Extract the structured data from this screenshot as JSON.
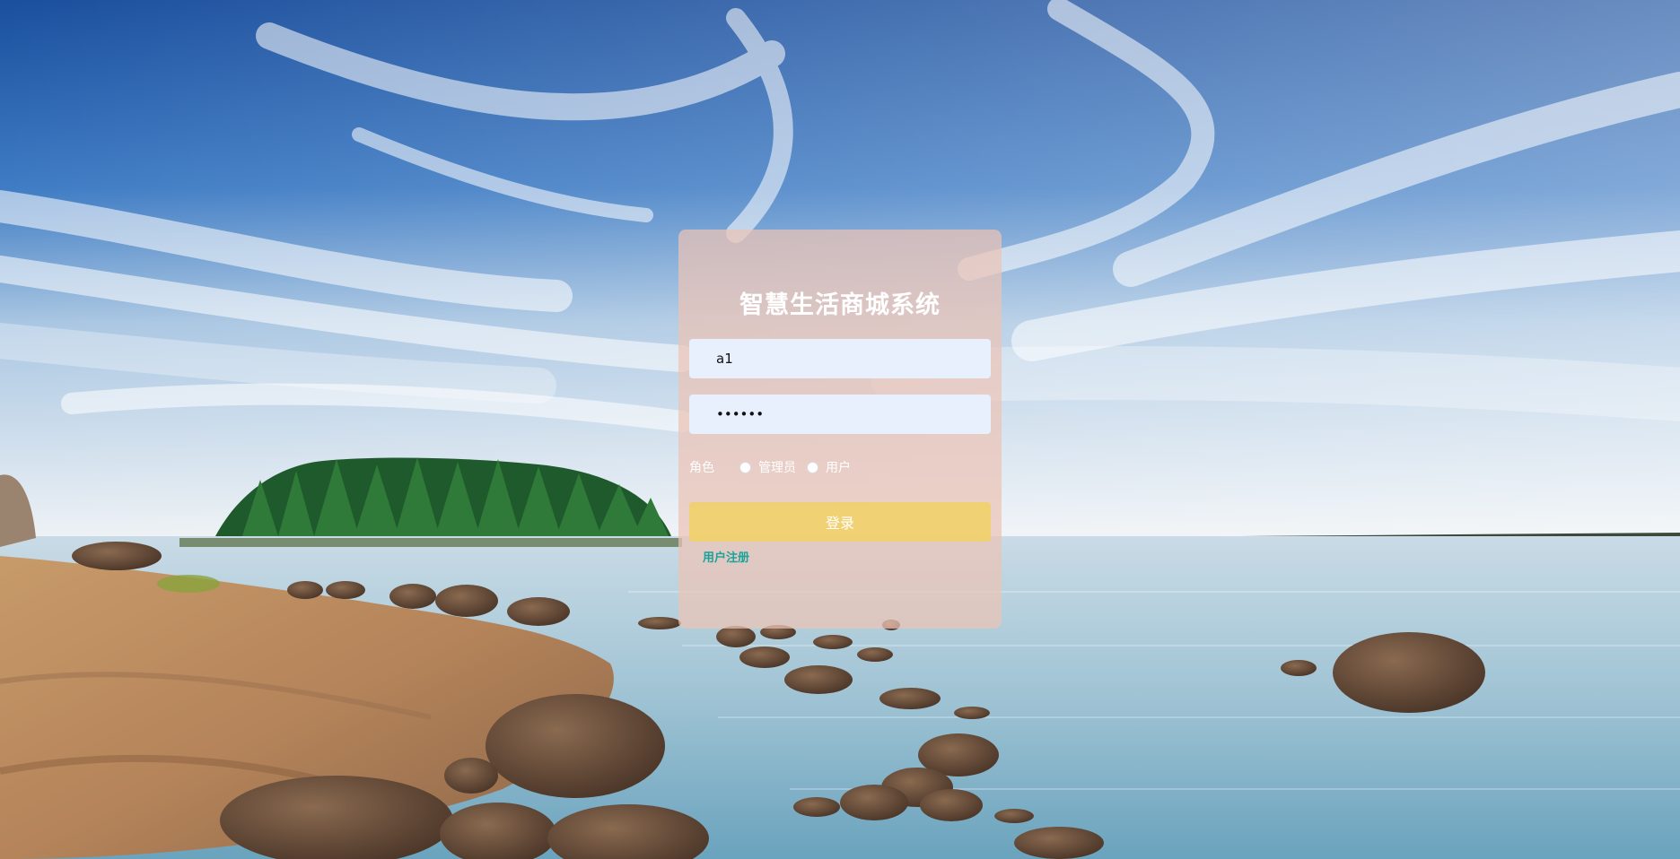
{
  "login": {
    "title": "智慧生活商城系统",
    "username_value": "a1",
    "password_value": "••••••",
    "role_label": "角色",
    "role_options": [
      "管理员",
      "用户"
    ],
    "login_button": "登录",
    "register_link": "用户注册"
  },
  "colors": {
    "card_bg": "#ecc4b6",
    "button_bg": "#f0d06c",
    "link": "#1aa39a",
    "input_bg": "#e8f0fe"
  }
}
